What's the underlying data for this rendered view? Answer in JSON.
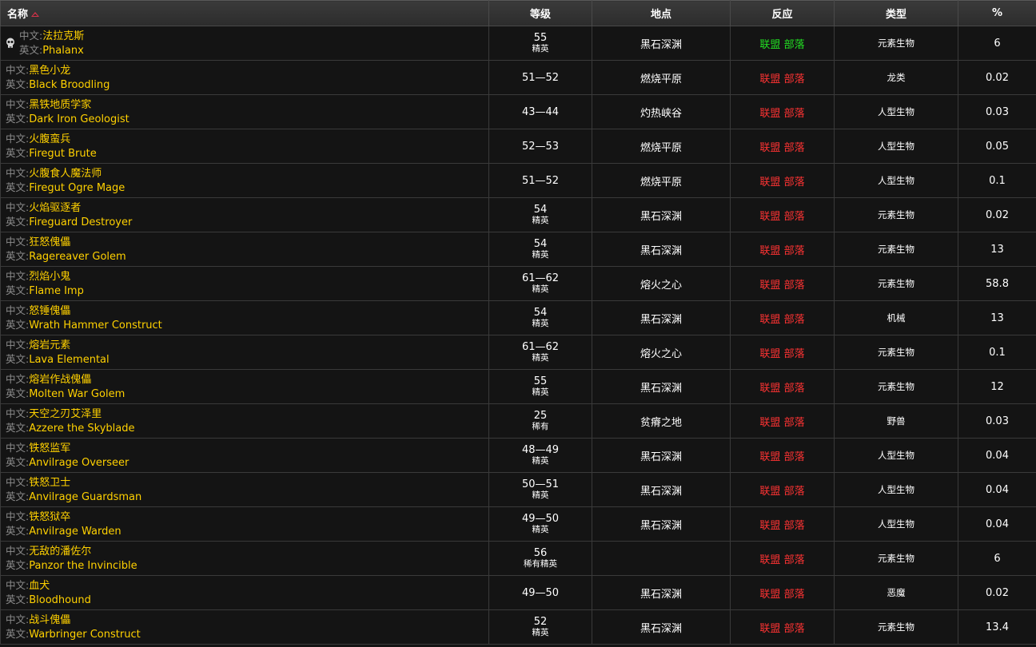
{
  "headers": {
    "name": "名称",
    "level": "等级",
    "location": "地点",
    "reaction": "反应",
    "type": "类型",
    "percent": "%"
  },
  "labels": {
    "cn": "中文:",
    "en": "英文:",
    "alliance": "联盟",
    "horde": "部落"
  },
  "rows": [
    {
      "cn": "法拉克斯",
      "en": "Phalanx",
      "level": "55",
      "class": "精英",
      "location": "黑石深渊",
      "reaction": "green",
      "type": "元素生物",
      "pct": "6",
      "skull": true
    },
    {
      "cn": "黑色小龙",
      "en": "Black Broodling",
      "level": "51—52",
      "class": "",
      "location": "燃烧平原",
      "reaction": "red",
      "type": "龙类",
      "pct": "0.02",
      "skull": false
    },
    {
      "cn": "黑铁地质学家",
      "en": "Dark Iron Geologist",
      "level": "43—44",
      "class": "",
      "location": "灼热峡谷",
      "reaction": "red",
      "type": "人型生物",
      "pct": "0.03",
      "skull": false
    },
    {
      "cn": "火腹蛮兵",
      "en": "Firegut Brute",
      "level": "52—53",
      "class": "",
      "location": "燃烧平原",
      "reaction": "red",
      "type": "人型生物",
      "pct": "0.05",
      "skull": false
    },
    {
      "cn": "火腹食人魔法师",
      "en": "Firegut Ogre Mage",
      "level": "51—52",
      "class": "",
      "location": "燃烧平原",
      "reaction": "red",
      "type": "人型生物",
      "pct": "0.1",
      "skull": false
    },
    {
      "cn": "火焰驱逐者",
      "en": "Fireguard Destroyer",
      "level": "54",
      "class": "精英",
      "location": "黑石深渊",
      "reaction": "red",
      "type": "元素生物",
      "pct": "0.02",
      "skull": false
    },
    {
      "cn": "狂怒傀儡",
      "en": "Ragereaver Golem",
      "level": "54",
      "class": "精英",
      "location": "黑石深渊",
      "reaction": "red",
      "type": "元素生物",
      "pct": "13",
      "skull": false
    },
    {
      "cn": "烈焰小鬼",
      "en": "Flame Imp",
      "level": "61—62",
      "class": "精英",
      "location": "熔火之心",
      "reaction": "red",
      "type": "元素生物",
      "pct": "58.8",
      "skull": false
    },
    {
      "cn": "怒锤傀儡",
      "en": "Wrath Hammer Construct",
      "level": "54",
      "class": "精英",
      "location": "黑石深渊",
      "reaction": "red",
      "type": "机械",
      "pct": "13",
      "skull": false
    },
    {
      "cn": "熔岩元素",
      "en": "Lava Elemental",
      "level": "61—62",
      "class": "精英",
      "location": "熔火之心",
      "reaction": "red",
      "type": "元素生物",
      "pct": "0.1",
      "skull": false
    },
    {
      "cn": "熔岩作战傀儡",
      "en": "Molten War Golem",
      "level": "55",
      "class": "精英",
      "location": "黑石深渊",
      "reaction": "red",
      "type": "元素生物",
      "pct": "12",
      "skull": false
    },
    {
      "cn": "天空之刃艾泽里",
      "en": "Azzere the Skyblade",
      "level": "25",
      "class": "稀有",
      "location": "贫瘠之地",
      "reaction": "red",
      "type": "野兽",
      "pct": "0.03",
      "skull": false
    },
    {
      "cn": "铁怒监军",
      "en": "Anvilrage Overseer",
      "level": "48—49",
      "class": "精英",
      "location": "黑石深渊",
      "reaction": "red",
      "type": "人型生物",
      "pct": "0.04",
      "skull": false
    },
    {
      "cn": "铁怒卫士",
      "en": "Anvilrage Guardsman",
      "level": "50—51",
      "class": "精英",
      "location": "黑石深渊",
      "reaction": "red",
      "type": "人型生物",
      "pct": "0.04",
      "skull": false
    },
    {
      "cn": "铁怒狱卒",
      "en": "Anvilrage Warden",
      "level": "49—50",
      "class": "精英",
      "location": "黑石深渊",
      "reaction": "red",
      "type": "人型生物",
      "pct": "0.04",
      "skull": false
    },
    {
      "cn": "无敌的潘佐尔",
      "en": "Panzor the Invincible",
      "level": "56",
      "class": "稀有精英",
      "location": "",
      "reaction": "red",
      "type": "元素生物",
      "pct": "6",
      "skull": false
    },
    {
      "cn": "血犬",
      "en": "Bloodhound",
      "level": "49—50",
      "class": "",
      "location": "黑石深渊",
      "reaction": "red",
      "type": "恶魔",
      "pct": "0.02",
      "skull": false
    },
    {
      "cn": "战斗傀儡",
      "en": "Warbringer Construct",
      "level": "52",
      "class": "精英",
      "location": "黑石深渊",
      "reaction": "red",
      "type": "元素生物",
      "pct": "13.4",
      "skull": false
    }
  ]
}
